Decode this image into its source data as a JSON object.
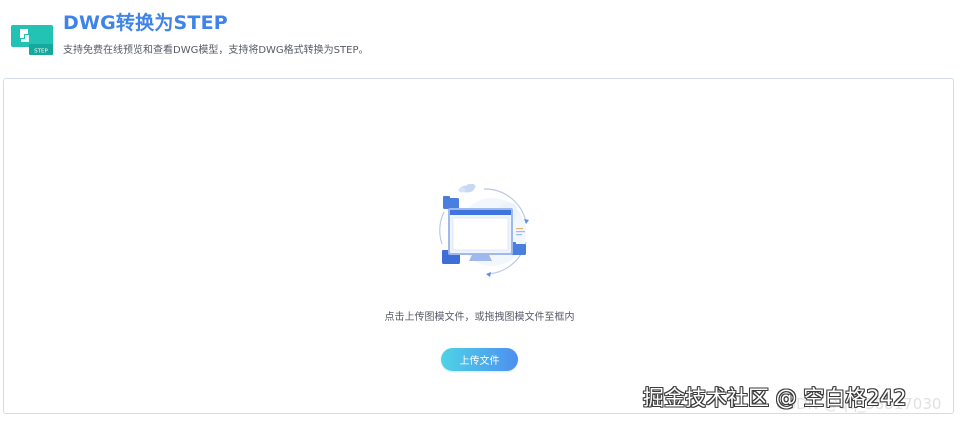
{
  "header": {
    "title": "DWG转换为STEP",
    "subtitle": "支持免费在线预览和查看DWG模型，支持将DWG格式转换为STEP。",
    "logo_text": "STEP"
  },
  "upload": {
    "hint": "点击上传图模文件，或拖拽图模文件至框内",
    "button_label": "上传文件"
  },
  "watermark": {
    "back_text": "CSDN @qq_38817030",
    "front_text": "掘金技术社区 @ 空白格242"
  },
  "colors": {
    "title_blue": "#3e84e8",
    "logo_teal": "#22c3b4",
    "button_gradient_start": "#4fd3e6",
    "button_gradient_end": "#4d8ff0",
    "zone_border": "#d4dbee"
  },
  "icons": {
    "logo": "step-file-logo-icon",
    "illustration": "upload-computer-illustration-icon"
  }
}
